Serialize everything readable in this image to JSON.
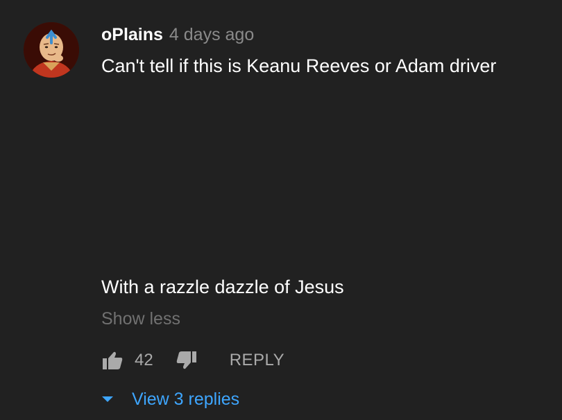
{
  "comment": {
    "author": "oPlains",
    "timestamp": "4 days ago",
    "avatar_icon": "aang-avatar-icon",
    "text_line_1": "Can't tell if this is Keanu Reeves or Adam driver",
    "text_line_2": "With a razzle dazzle of Jesus",
    "show_less_label": "Show less",
    "like_count": "42",
    "reply_label": "REPLY",
    "view_replies_label": "View 3 replies"
  },
  "colors": {
    "background": "#212121",
    "primary_text": "#ffffff",
    "secondary_text": "#aaaaaa",
    "link_blue": "#3ea6ff"
  },
  "icons": {
    "like": "thumbs-up-icon",
    "dislike": "thumbs-down-icon",
    "expand": "caret-down-icon"
  }
}
